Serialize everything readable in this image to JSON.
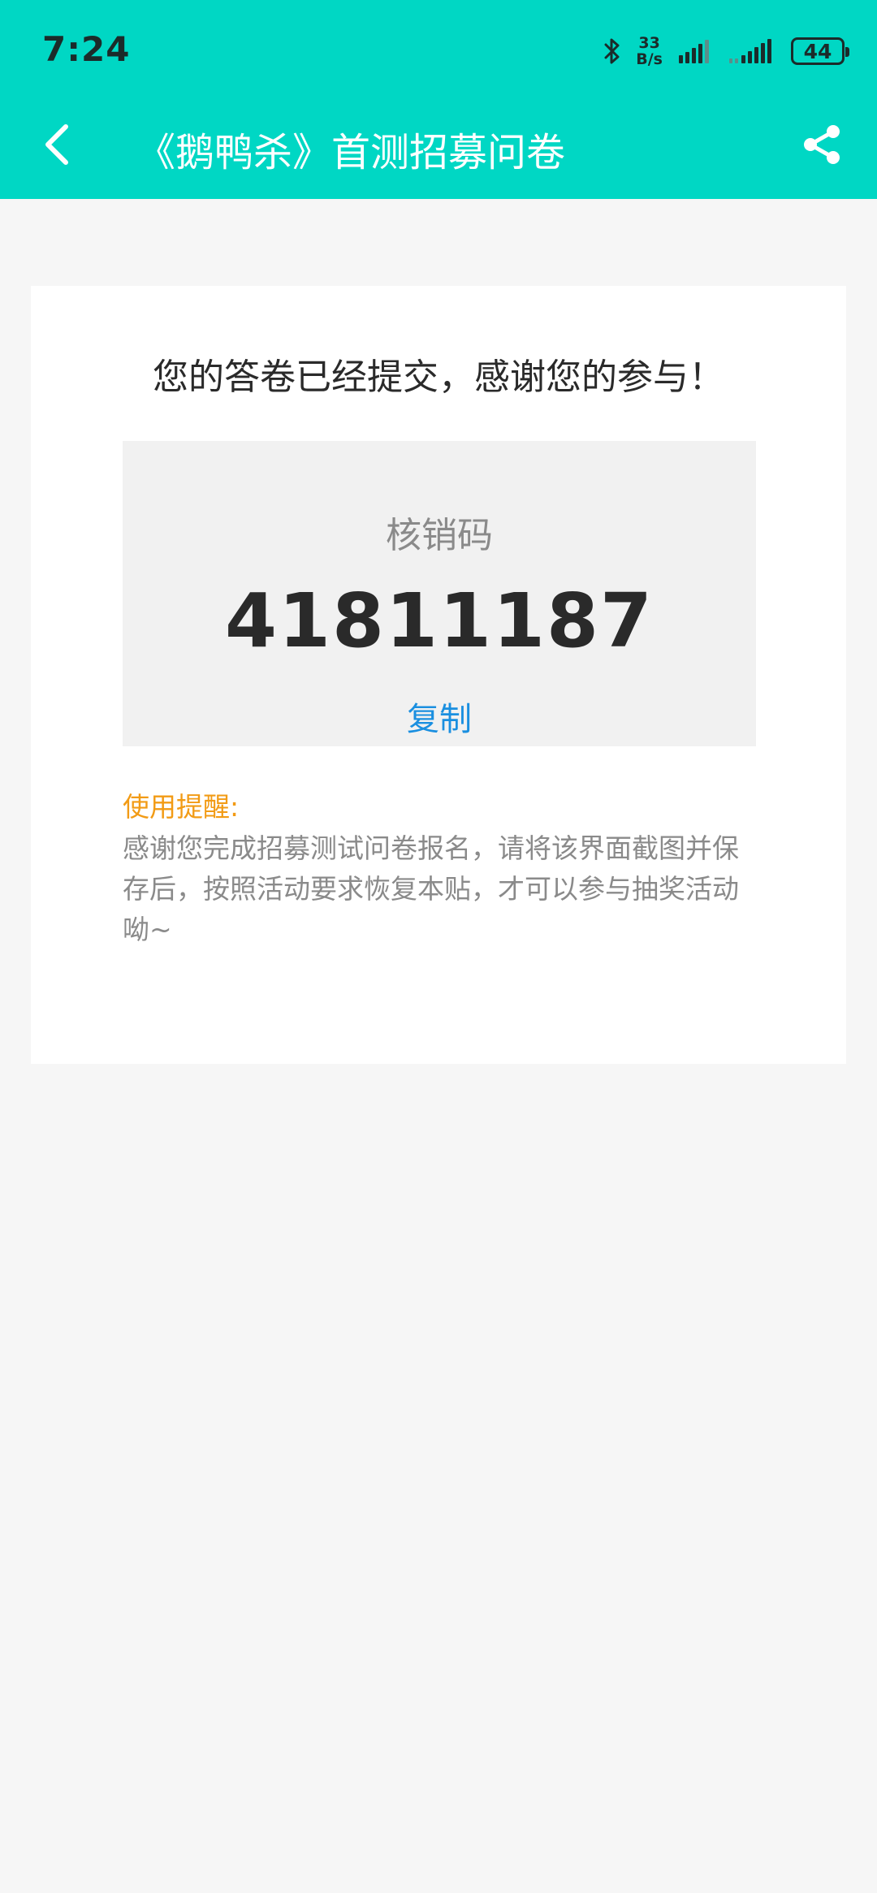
{
  "status_bar": {
    "time": "7:24",
    "net_speed_value": "33",
    "net_speed_unit": "B/s",
    "battery": "44"
  },
  "navbar": {
    "title": "《鹅鸭杀》首测招募问卷"
  },
  "card": {
    "success_message": "您的答卷已经提交，感谢您的参与！",
    "code_label": "核销码",
    "code_value": "41811187",
    "copy_label": "复制",
    "tip_title": "使用提醒:",
    "tip_body": "感谢您完成招募测试问卷报名，请将该界面截图并保存后，按照活动要求恢复本贴，才可以参与抽奖活动呦~"
  },
  "colors": {
    "header_bg": "#00d7c4",
    "page_bg": "#f6f6f6",
    "copy_link": "#1a8fe0",
    "tip_title": "#f29b15"
  },
  "icons": [
    "bluetooth-icon",
    "signal-icon",
    "back-arrow-icon",
    "share-icon"
  ]
}
